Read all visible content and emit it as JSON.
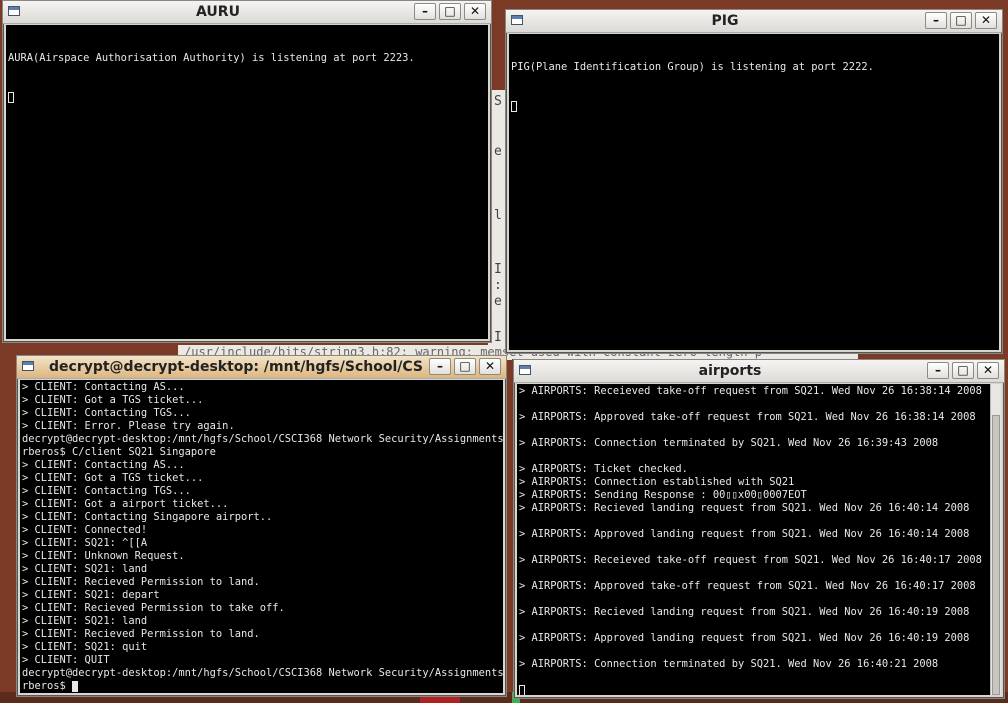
{
  "behind": {
    "strip_chars": [
      "S",
      "e",
      "l",
      "I",
      ":",
      "e",
      "I"
    ],
    "compile_line": "/usr/include/bits/string3.h:82: warning: memset used with constant zero length p"
  },
  "windows": {
    "auru": {
      "title": "AURU",
      "lines": [
        "AURA(Airspace Authorisation Authority) is listening at port 2223."
      ]
    },
    "pig": {
      "title": "PIG",
      "lines": [
        "PIG(Plane Identification Group) is listening at port 2222."
      ]
    },
    "client": {
      "title": "decrypt@decrypt-desktop: /mnt/hgfs/School/CSCI",
      "lines": [
        "> CLIENT: Contacting AS...",
        "> CLIENT: Got a TGS ticket...",
        "> CLIENT: Contacting TGS...",
        "> CLIENT: Error. Please try again.",
        "decrypt@decrypt-desktop:/mnt/hgfs/School/CSCI368 Network Security/Assignments/Ke",
        "rberos$ C/client SQ21 Singapore",
        "> CLIENT: Contacting AS...",
        "> CLIENT: Got a TGS ticket...",
        "> CLIENT: Contacting TGS...",
        "> CLIENT: Got a airport ticket...",
        "> CLIENT: Contacting Singapore airport..",
        "> CLIENT: Connected!",
        "> CLIENT: SQ21: ^[[A",
        "> CLIENT: Unknown Request.",
        "> CLIENT: SQ21: land",
        "> CLIENT: Recieved Permission to land.",
        "> CLIENT: SQ21: depart",
        "> CLIENT: Recieved Permission to take off.",
        "> CLIENT: SQ21: land",
        "> CLIENT: Recieved Permission to land.",
        "> CLIENT: SQ21: quit",
        "> CLIENT: QUIT",
        "decrypt@decrypt-desktop:/mnt/hgfs/School/CSCI368 Network Security/Assignments/Ke",
        "rberos$ "
      ]
    },
    "airports": {
      "title": "airports",
      "lines": [
        "> AIRPORTS: Receieved take-off request from SQ21. Wed Nov 26 16:38:14 2008",
        "",
        "> AIRPORTS: Approved take-off request from SQ21. Wed Nov 26 16:38:14 2008",
        "",
        "> AIRPORTS: Connection terminated by SQ21. Wed Nov 26 16:39:43 2008",
        "",
        "> AIRPORTS: Ticket checked.",
        "> AIRPORTS: Connection established with SQ21",
        "> AIRPORTS: Sending Response : 00▯▯x00▯0007EOT",
        "> AIRPORTS: Recieved landing request from SQ21. Wed Nov 26 16:40:14 2008",
        "",
        "> AIRPORTS: Approved landing request from SQ21. Wed Nov 26 16:40:14 2008",
        "",
        "> AIRPORTS: Receieved take-off request from SQ21. Wed Nov 26 16:40:17 2008",
        "",
        "> AIRPORTS: Approved take-off request from SQ21. Wed Nov 26 16:40:17 2008",
        "",
        "> AIRPORTS: Recieved landing request from SQ21. Wed Nov 26 16:40:19 2008",
        "",
        "> AIRPORTS: Approved landing request from SQ21. Wed Nov 26 16:40:19 2008",
        "",
        "> AIRPORTS: Connection terminated by SQ21. Wed Nov 26 16:40:21 2008",
        "",
        ""
      ]
    }
  },
  "controls": {
    "minimize": "–",
    "maximize": "□",
    "close": "✕"
  },
  "colors": {
    "terminal_bg": "#000000",
    "terminal_fg": "#e8e8e8",
    "active_title": "#dcb680",
    "desktop": "#7a3a26"
  }
}
